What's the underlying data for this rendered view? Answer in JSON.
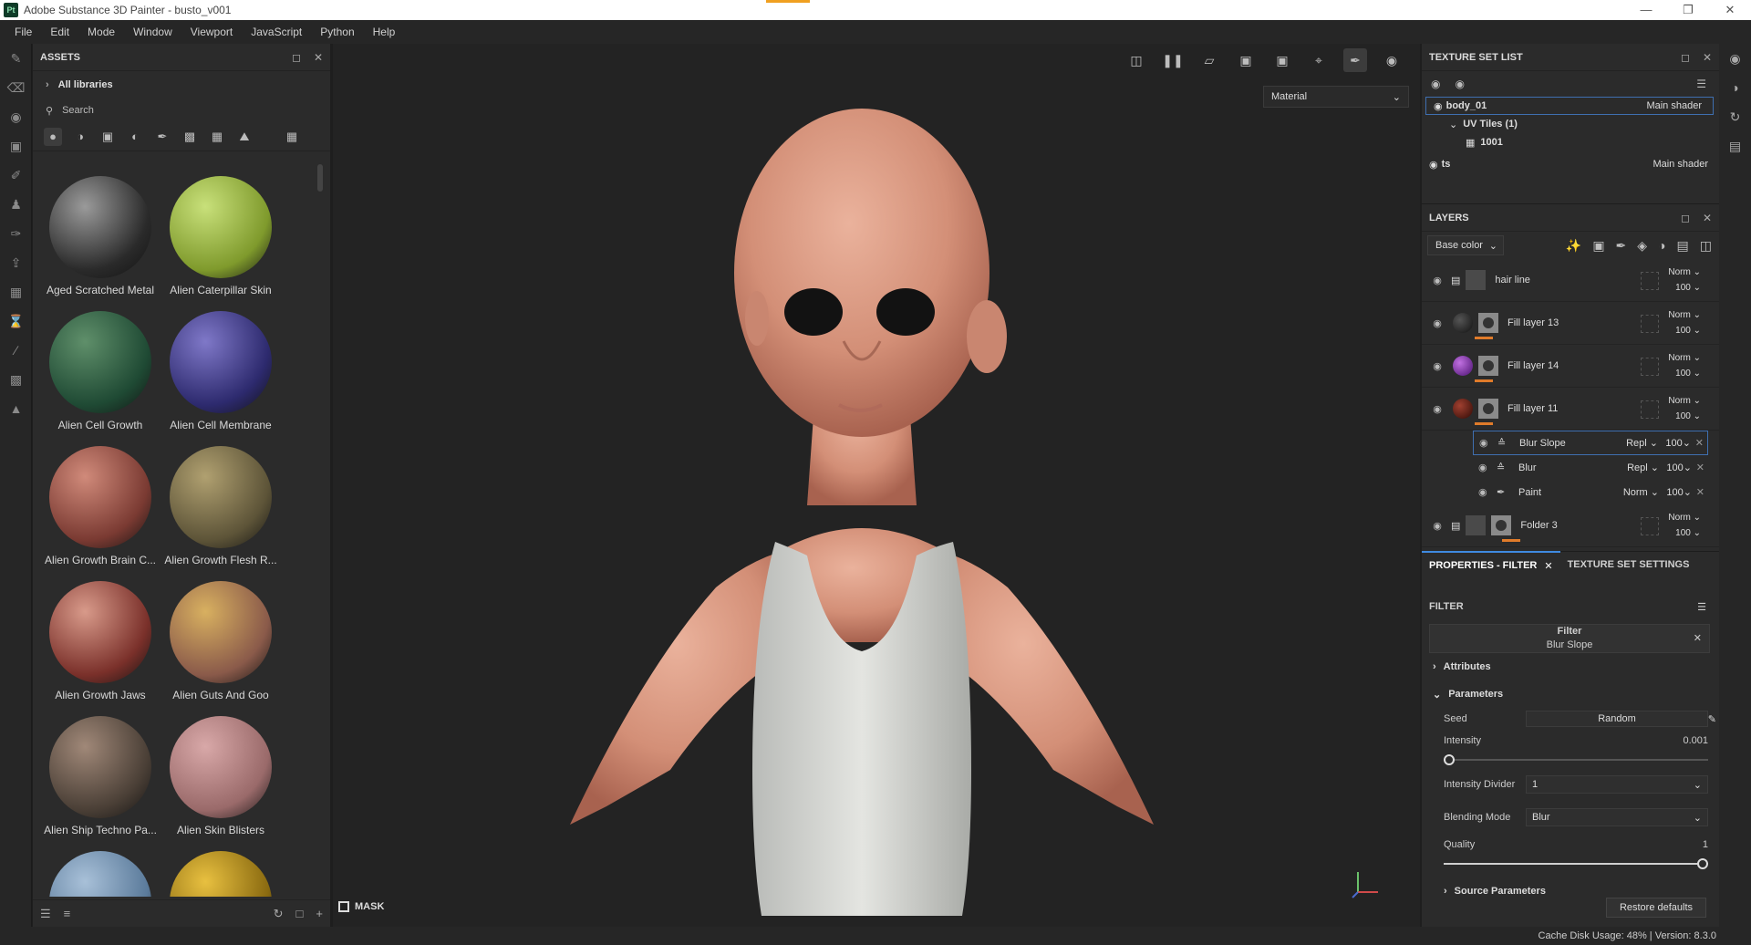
{
  "window": {
    "title": "Adobe Substance 3D Painter - busto_v001",
    "logo": "Pt"
  },
  "menu": [
    "File",
    "Edit",
    "Mode",
    "Window",
    "Viewport",
    "JavaScript",
    "Python",
    "Help"
  ],
  "assets": {
    "title": "ASSETS",
    "library": "All libraries",
    "search_placeholder": "Search",
    "items": [
      {
        "label": "Aged Scratched Metal",
        "color": "#2a2a2a",
        "hi": "#9a9a9a"
      },
      {
        "label": "Alien Caterpillar Skin",
        "color": "#7f9a2c",
        "hi": "#c8e07a"
      },
      {
        "label": "Alien Cell Growth",
        "color": "#1f4a34",
        "hi": "#5f8f6a"
      },
      {
        "label": "Alien Cell Membrane",
        "color": "#2d2a6e",
        "hi": "#7f78c8"
      },
      {
        "label": "Alien Growth Brain C...",
        "color": "#7a3a32",
        "hi": "#d08a7a"
      },
      {
        "label": "Alien Growth Flesh R...",
        "color": "#5d5438",
        "hi": "#b0a070"
      },
      {
        "label": "Alien Growth Jaws",
        "color": "#7a302a",
        "hi": "#d89a8a"
      },
      {
        "label": "Alien Guts And Goo",
        "color": "#8a5a4a",
        "hi": "#d8b060"
      },
      {
        "label": "Alien Ship Techno Pa...",
        "color": "#4a3f36",
        "hi": "#a08878"
      },
      {
        "label": "Alien Skin Blisters",
        "color": "#9a6a6a",
        "hi": "#d8a8a8"
      },
      {
        "label": "",
        "color": "#5a7a9a",
        "hi": "#a8c0d8"
      },
      {
        "label": "",
        "color": "#8a6a10",
        "hi": "#e8c040"
      }
    ]
  },
  "viewport": {
    "material_mode": "Material",
    "mask_label": "MASK"
  },
  "texture_set_list": {
    "title": "TEXTURE SET LIST",
    "rows": [
      {
        "name": "body_01",
        "shader": "Main shader"
      },
      {
        "name": "UV Tiles (1)",
        "shader": ""
      },
      {
        "name": "1001",
        "shader": ""
      },
      {
        "name": "ts",
        "shader": "Main shader"
      }
    ]
  },
  "layers": {
    "title": "LAYERS",
    "channel": "Base color",
    "items": [
      {
        "name": "hair line",
        "blend": "Norm",
        "opacity": "100",
        "type": "folder",
        "color": ""
      },
      {
        "name": "Fill layer 13",
        "blend": "Norm",
        "opacity": "100",
        "type": "fill",
        "color": "#111111"
      },
      {
        "name": "Fill layer 14",
        "blend": "Norm",
        "opacity": "100",
        "type": "fill",
        "color": "#7a2aa0"
      },
      {
        "name": "Fill layer 11",
        "blend": "Norm",
        "opacity": "100",
        "type": "fill",
        "color": "#5a1a10"
      }
    ],
    "effects": [
      {
        "name": "Blur Slope",
        "blend": "Repl",
        "opacity": "100"
      },
      {
        "name": "Blur",
        "blend": "Repl",
        "opacity": "100"
      },
      {
        "name": "Paint",
        "blend": "Norm",
        "opacity": "100"
      }
    ],
    "folder3": {
      "name": "Folder 3",
      "blend": "Norm",
      "opacity": "100"
    }
  },
  "properties": {
    "tab_filter": "PROPERTIES - FILTER",
    "tab_tss": "TEXTURE SET SETTINGS",
    "filter_title": "FILTER",
    "filter_box_title": "Filter",
    "filter_name": "Blur Slope",
    "attributes": "Attributes",
    "parameters": "Parameters",
    "seed_label": "Seed",
    "seed_value": "Random",
    "intensity_label": "Intensity",
    "intensity_value": "0.001",
    "intensity_fraction": 0.0,
    "intensity_divider_label": "Intensity Divider",
    "intensity_divider_value": "1",
    "blending_mode_label": "Blending Mode",
    "blending_mode_value": "Blur",
    "quality_label": "Quality",
    "quality_value": "1",
    "quality_fraction": 1.0,
    "source_parameters": "Source Parameters",
    "restore": "Restore defaults"
  },
  "status": {
    "text": "Cache Disk Usage:   48% | Version: 8.3.0"
  }
}
